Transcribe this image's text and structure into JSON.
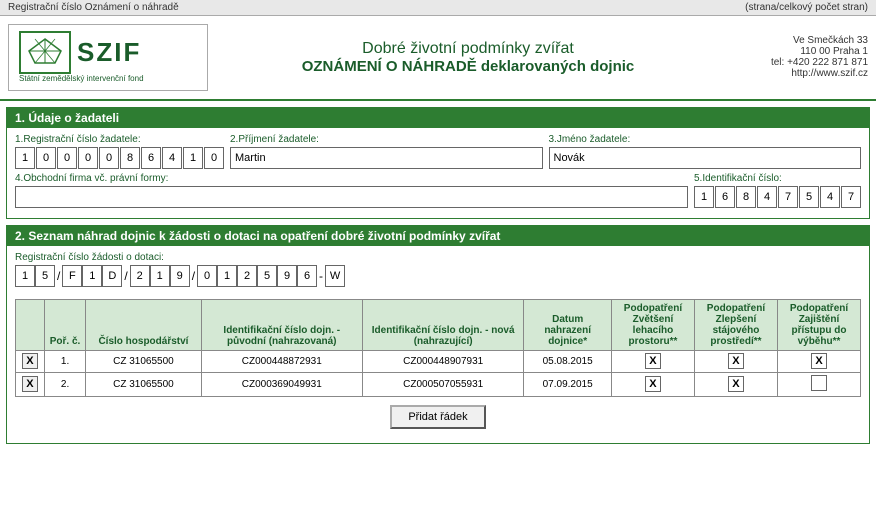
{
  "topbar": {
    "left": "Registrační číslo Oznámení o náhradě",
    "right": "(strana/celkový počet stran)"
  },
  "header": {
    "logo_symbol": "🌾",
    "logo_name": "SZIF",
    "logo_subtitle": "Státní zemědělský intervenční fond",
    "title": "Dobré životní podmínky zvířat",
    "subtitle": "OZNÁMENÍ O NÁHRADĚ deklarovaných dojnic",
    "address_line1": "Ve Smečkách 33",
    "address_line2": "110 00 Praha 1",
    "address_line3": "tel: +420 222 871 871",
    "address_line4": "http://www.szif.cz"
  },
  "section1": {
    "title": "1. Údaje o žadateli",
    "reg_label": "1.Registrační číslo žadatele:",
    "reg_digits": [
      "1",
      "0",
      "0",
      "0",
      "0",
      "8",
      "6",
      "4",
      "1",
      "0"
    ],
    "prijmeni_label": "2.Příjmení žadatele:",
    "prijmeni_value": "Martin",
    "jmeno_label": "3.Jméno žadatele:",
    "jmeno_value": "Novák",
    "obchodni_label": "4.Obchodní firma vč. právní formy:",
    "obchodni_value": "",
    "ident_label": "5.Identifikační číslo:",
    "ident_digits": [
      "1",
      "6",
      "8",
      "4",
      "7",
      "5",
      "4",
      "7"
    ]
  },
  "section2": {
    "title": "2. Seznam náhrad dojnic k žádosti o dotaci na opatření dobré životní podmínky zvířat",
    "reg_zadost_label": "Registrační číslo žádosti o dotaci:",
    "reg_zadost_parts": {
      "p1": [
        "1",
        "5"
      ],
      "p2": [
        "F",
        "1",
        "D"
      ],
      "p3": [
        "2",
        "1",
        "9"
      ],
      "p4": [
        "0",
        "1",
        "2",
        "5",
        "9",
        "6"
      ],
      "p5": [
        "W"
      ]
    },
    "table_headers": {
      "por": "Poř. č.",
      "cislo_hosp": "Číslo hospodářství",
      "ident_puvodni": "Identifikační číslo dojn. - původní (nahrazovaná)",
      "ident_nova": "Identifikační číslo dojn. - nová (nahrazující)",
      "datum": "Datum nahrazení dojnice*",
      "podop_zvetseni": "Podopatření Zvětšení lehacího prostoru**",
      "podop_zlepseni": "Podopatření Zlepšení stájového prostředí**",
      "podop_zajisteni": "Podopatření Zajištění přístupu do výběhu**"
    },
    "rows": [
      {
        "delete": "X",
        "por": "1.",
        "cislo_hosp": "CZ 31065500",
        "ident_puvodni": "CZ000448872931",
        "ident_nova": "CZ000448907931",
        "datum": "05.08.2015",
        "zvetseni": "X",
        "zlepseni": "X",
        "zajisteni": "X"
      },
      {
        "delete": "X",
        "por": "2.",
        "cislo_hosp": "CZ 31065500",
        "ident_puvodni": "CZ000369049931",
        "ident_nova": "CZ000507055931",
        "datum": "07.09.2015",
        "zvetseni": "X",
        "zlepseni": "X",
        "zajisteni": ""
      }
    ],
    "add_button_label": "Přidat řádek"
  }
}
